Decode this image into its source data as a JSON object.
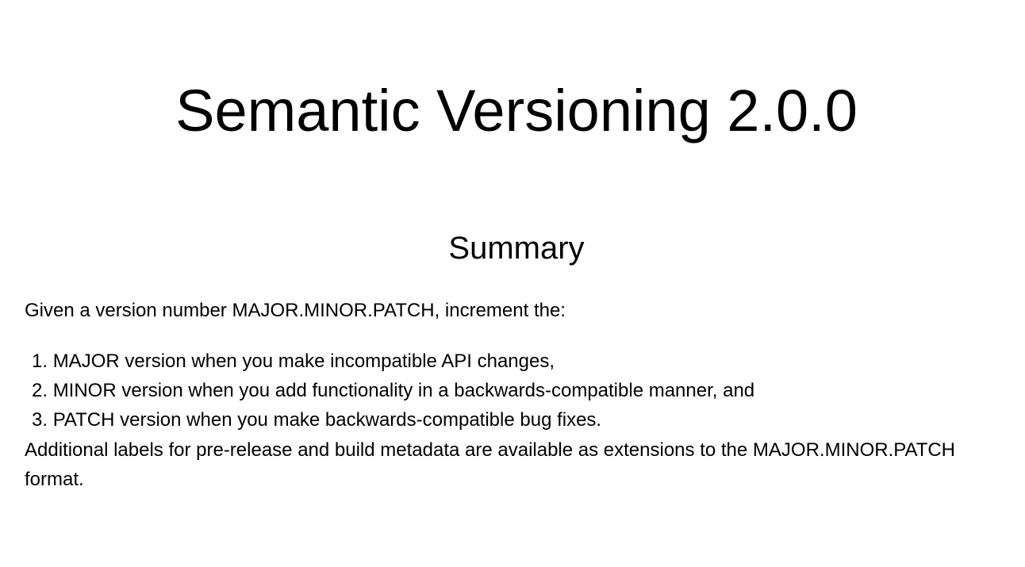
{
  "header": {
    "title": "Semantic Versioning 2.0.0"
  },
  "summary": {
    "heading": "Summary",
    "intro": "Given a version number MAJOR.MINOR.PATCH, increment the:",
    "items": [
      {
        "marker": "1.",
        "text": "MAJOR version when you make incompatible API changes,"
      },
      {
        "marker": "2.",
        "text": "MINOR version when you add functionality in a backwards-compatible manner, and"
      },
      {
        "marker": "3.",
        "text": "PATCH version when you make backwards-compatible bug fixes."
      }
    ],
    "closing": "Additional labels for pre-release and build metadata are available as extensions to the MAJOR.MINOR.PATCH format."
  }
}
